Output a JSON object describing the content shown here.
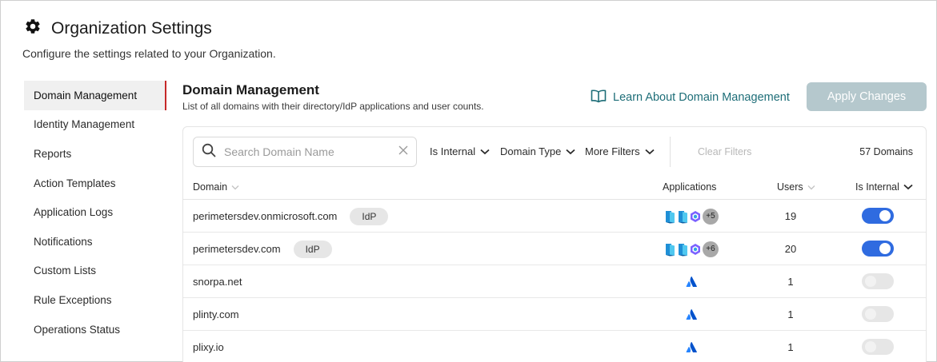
{
  "header": {
    "title": "Organization Settings",
    "subtitle": "Configure the settings related to your Organization."
  },
  "sidebar": {
    "items": [
      {
        "label": "Domain Management",
        "active": true
      },
      {
        "label": "Identity Management"
      },
      {
        "label": "Reports"
      },
      {
        "label": "Action Templates"
      },
      {
        "label": "Application Logs"
      },
      {
        "label": "Notifications"
      },
      {
        "label": "Custom Lists"
      },
      {
        "label": "Rule Exceptions"
      },
      {
        "label": "Operations Status"
      }
    ]
  },
  "main": {
    "title": "Domain Management",
    "subtitle": "List of all domains with their directory/IdP applications and user counts.",
    "learn_link": "Learn About Domain Management",
    "apply_button": "Apply Changes"
  },
  "toolbar": {
    "search_placeholder": "Search Domain Name",
    "filters": [
      "Is Internal",
      "Domain Type",
      "More Filters"
    ],
    "clear_filters": "Clear Filters",
    "domain_count": "57 Domains"
  },
  "table": {
    "columns": [
      "Domain",
      "Applications",
      "Users",
      "Is Internal"
    ],
    "rows": [
      {
        "domain": "perimetersdev.onmicrosoft.com",
        "badge": "IdP",
        "apps": "entra-multi",
        "more": "+5",
        "users": "19",
        "internal": true
      },
      {
        "domain": "perimetersdev.com",
        "badge": "IdP",
        "apps": "entra-multi",
        "more": "+6",
        "users": "20",
        "internal": true
      },
      {
        "domain": "snorpa.net",
        "badge": "",
        "apps": "atlassian",
        "more": "",
        "users": "1",
        "internal": false
      },
      {
        "domain": "plinty.com",
        "badge": "",
        "apps": "atlassian",
        "more": "",
        "users": "1",
        "internal": false
      },
      {
        "domain": "plixy.io",
        "badge": "",
        "apps": "atlassian",
        "more": "",
        "users": "1",
        "internal": false
      }
    ]
  },
  "colors": {
    "accent": "#1e6e78",
    "active_border": "#c62828",
    "toggle_on": "#2f6be0",
    "apply_disabled": "#b5c8cd"
  },
  "icons": {
    "header": "gear-icon",
    "learn": "book-open-icon",
    "search": "search-icon",
    "clear": "close-icon",
    "filter": "chevron-down-icon",
    "sort": "sort-chevron-icon"
  }
}
